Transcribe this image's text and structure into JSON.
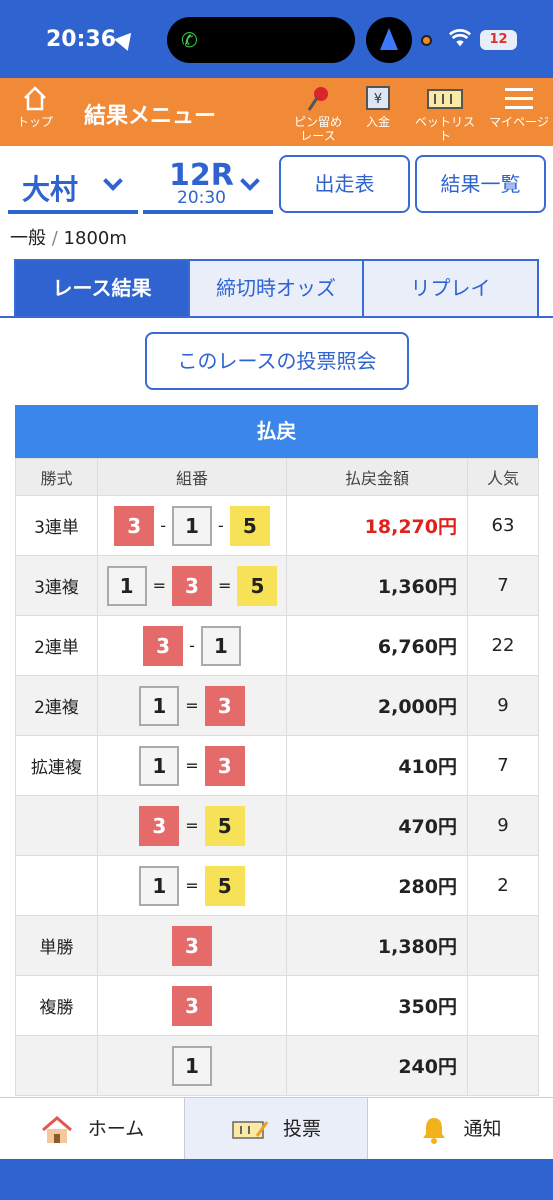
{
  "status": {
    "time": "20:36",
    "battery": "12"
  },
  "header": {
    "title": "結果メニュー",
    "top_label": "トップ",
    "pin_label_1": "ピン留め",
    "pin_label_2": "レース",
    "deposit_label": "入金",
    "betlist_label": "ベットリスト",
    "mypage_label": "マイページ"
  },
  "selectors": {
    "venue": "大村",
    "race": "12R",
    "race_time": "20:30"
  },
  "buttons": {
    "entry_table": "出走表",
    "results_list": "結果一覧",
    "inquiry": "このレースの投票照会"
  },
  "race_info": {
    "class": "一般",
    "sep": "/",
    "distance": "1800m"
  },
  "tabs": [
    "レース結果",
    "締切時オッズ",
    "リプレイ"
  ],
  "payout": {
    "title": "払戻",
    "headers": [
      "勝式",
      "組番",
      "払戻金額",
      "人気"
    ],
    "rows": [
      {
        "type": "3連単",
        "combo": [
          "3",
          "-",
          "1",
          "-",
          "5"
        ],
        "amount": "18,270円",
        "pop": "63"
      },
      {
        "type": "3連複",
        "combo": [
          "1",
          "=",
          "3",
          "=",
          "5"
        ],
        "amount": "1,360円",
        "pop": "7"
      },
      {
        "type": "2連単",
        "combo": [
          "3",
          "-",
          "1"
        ],
        "amount": "6,760円",
        "pop": "22"
      },
      {
        "type": "2連複",
        "combo": [
          "1",
          "=",
          "3"
        ],
        "amount": "2,000円",
        "pop": "9"
      },
      {
        "type": "拡連複",
        "combo": [
          "1",
          "=",
          "3"
        ],
        "amount": "410円",
        "pop": "7"
      },
      {
        "type": "",
        "combo": [
          "3",
          "=",
          "5"
        ],
        "amount": "470円",
        "pop": "9"
      },
      {
        "type": "",
        "combo": [
          "1",
          "=",
          "5"
        ],
        "amount": "280円",
        "pop": "2"
      },
      {
        "type": "単勝",
        "combo": [
          "3"
        ],
        "amount": "1,380円",
        "pop": ""
      },
      {
        "type": "複勝",
        "combo": [
          "3"
        ],
        "amount": "350円",
        "pop": ""
      },
      {
        "type": "",
        "combo": [
          "1"
        ],
        "amount": "240円",
        "pop": ""
      }
    ]
  },
  "bottom_nav": {
    "home": "ホーム",
    "bet": "投票",
    "notify": "通知"
  },
  "colors": {
    "primary": "#2f64d0",
    "orange": "#f08a36",
    "boat3": "#e56b6b",
    "boat5": "#f7e257",
    "highlight": "#e0201a"
  }
}
